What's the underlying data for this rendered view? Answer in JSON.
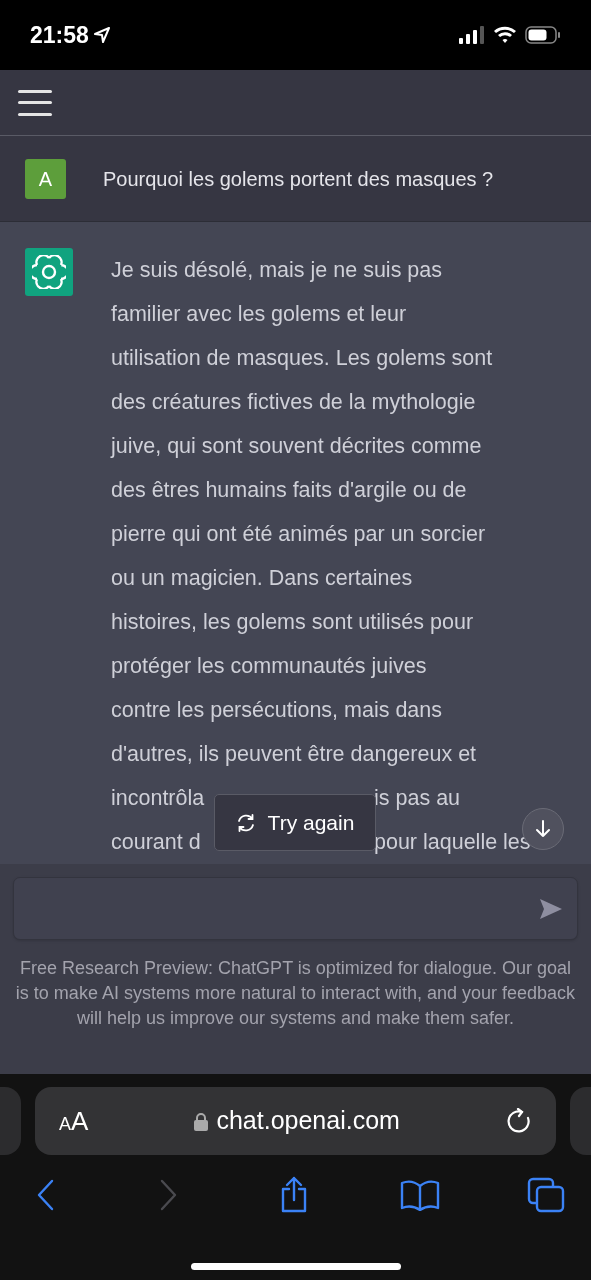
{
  "status_bar": {
    "time": "21:58"
  },
  "question": {
    "avatar": "A",
    "text": "Pourquoi les golems portent des masques ?"
  },
  "answer": {
    "lines": [
      {
        "parts": [
          "Je suis désolé, mais je ne suis pas"
        ]
      },
      {
        "parts": [
          "familier avec les golems et leur"
        ]
      },
      {
        "parts": [
          "utilisation de masques. Les golems sont"
        ]
      },
      {
        "parts": [
          "des créatures fictives de la mythologie"
        ]
      },
      {
        "parts": [
          "juive, qui sont souvent décrites comme"
        ]
      },
      {
        "parts": [
          "des êtres humains faits d'argile ou de"
        ]
      },
      {
        "parts": [
          "pierre qui ont été animés par un sorcier"
        ]
      },
      {
        "parts": [
          "ou un magicien. Dans certaines"
        ]
      },
      {
        "parts": [
          "histoires, les golems sont utilisés pour"
        ]
      },
      {
        "parts": [
          "protéger les communautés juives"
        ]
      },
      {
        "parts": [
          "contre les persécutions, mais dans"
        ]
      },
      {
        "parts": [
          "d'autres, ils peuvent être dangereux et"
        ]
      },
      {
        "parts": [
          "incontrôla",
          "is pas au"
        ]
      },
      {
        "parts": [
          "courant d",
          "pour laquelle les"
        ]
      }
    ]
  },
  "try_again": {
    "label": "Try again"
  },
  "footer": "Free Research Preview: ChatGPT is optimized for dialogue. Our goal is to make AI systems more natural to interact with, and your feedback will help us improve our systems and make them safer.",
  "browser": {
    "text_size": "AA",
    "url": "chat.openai.com",
    "toolbar": [
      {
        "kind": "back",
        "disabled": false
      },
      {
        "kind": "forward",
        "disabled": true
      },
      {
        "kind": "share",
        "disabled": false
      },
      {
        "kind": "bookmarks",
        "disabled": false
      },
      {
        "kind": "tabs",
        "disabled": false
      }
    ]
  }
}
